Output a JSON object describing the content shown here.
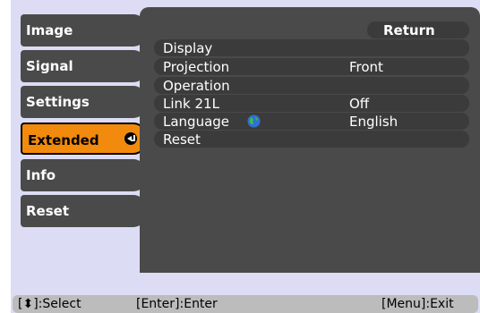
{
  "menu": {
    "tabs": [
      {
        "label": "Image"
      },
      {
        "label": "Signal"
      },
      {
        "label": "Settings"
      },
      {
        "label": "Extended"
      },
      {
        "label": "Info"
      },
      {
        "label": "Reset"
      }
    ],
    "active_tab": "Extended"
  },
  "panel": {
    "return_label": "Return",
    "rows": [
      {
        "label": "Display",
        "value": ""
      },
      {
        "label": "Projection",
        "value": "Front"
      },
      {
        "label": "Operation",
        "value": ""
      },
      {
        "label": "Link 21L",
        "value": "Off"
      },
      {
        "label": "Language",
        "value": "English"
      },
      {
        "label": "Reset",
        "value": ""
      }
    ]
  },
  "help": {
    "select": "[⬍]:Select",
    "enter": "[Enter]:Enter",
    "exit": "[Menu]:Exit"
  },
  "colors": {
    "accent": "#f28a0d",
    "panel": "#4a4a4a",
    "row": "#3b3b3b",
    "background": "#dcdcf4"
  }
}
